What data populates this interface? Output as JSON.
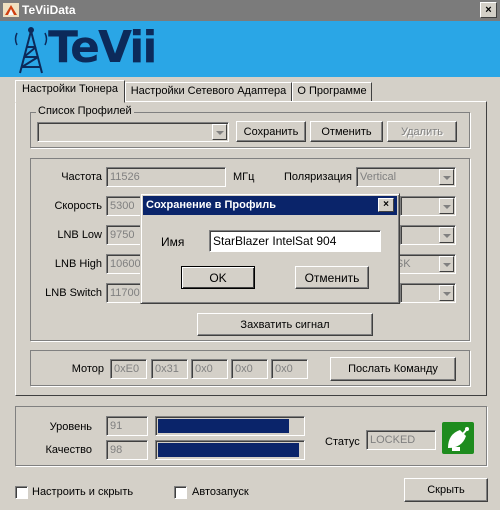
{
  "window": {
    "title": "TeViiData",
    "close_glyph": "×"
  },
  "banner": {
    "logo_text": "TeVii",
    "logo_icon": "antenna-tower-icon"
  },
  "tabs": [
    {
      "label": "Настройки Тюнера",
      "active": true
    },
    {
      "label": "Настройки Сетевого Адаптера",
      "active": false
    },
    {
      "label": "О Программе",
      "active": false
    }
  ],
  "profiles": {
    "legend": "Список Профилей",
    "selected": "",
    "save_label": "Сохранить",
    "cancel_label": "Отменить",
    "delete_label": "Удалить"
  },
  "tuner": {
    "frequency_label": "Частота",
    "frequency_value": "11526",
    "frequency_unit": "МГц",
    "polarization_label": "Поляризация",
    "polarization_value": "Vertical",
    "speed_label": "Скорость",
    "speed_value": "5300",
    "lnb_low_label": "LNB Low",
    "lnb_low_value": "9750",
    "lnb_high_label": "LNB High",
    "lnb_high_value": "10600",
    "modulation_value": "QPSK",
    "lnb_switch_label": "LNB Switch",
    "lnb_switch_value": "11700",
    "capture_label": "Захватить сигнал"
  },
  "motor": {
    "label": "Мотор",
    "bytes": [
      "0xE0",
      "0x31",
      "0x0",
      "0x0",
      "0x0"
    ],
    "send_label": "Послать Команду"
  },
  "signal": {
    "level_label": "Уровень",
    "level_value": "91",
    "level_fraction": 0.91,
    "quality_label": "Качество",
    "quality_value": "98",
    "quality_fraction": 0.98,
    "status_label": "Статус",
    "status_value": "LOCKED",
    "status_icon": "satellite-dish-icon",
    "status_color": "#1e8c1e",
    "bar_color": "#0a246a"
  },
  "footer": {
    "tune_hide_label": "Настроить и скрыть",
    "autostart_label": "Автозапуск",
    "hide_label": "Скрыть"
  },
  "dialog": {
    "title": "Сохранение в Профиль",
    "name_label": "Имя",
    "name_value": "StarBlazer IntelSat 904",
    "ok_label": "OK",
    "cancel_label": "Отменить"
  }
}
